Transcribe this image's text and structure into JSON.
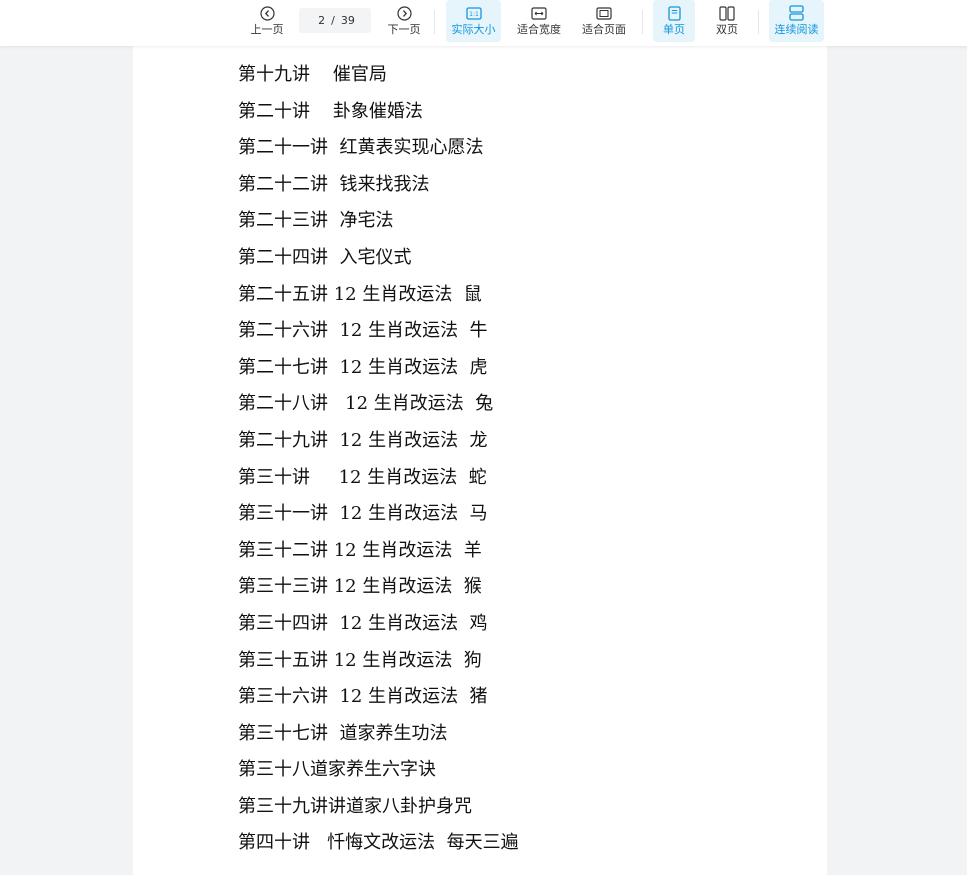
{
  "toolbar": {
    "prev_label": "上一页",
    "next_label": "下一页",
    "current_page": "2",
    "page_separator": "/",
    "total_pages": "39",
    "actual_size_label": "实际大小",
    "fit_width_label": "适合宽度",
    "fit_page_label": "适合页面",
    "single_page_label": "单页",
    "double_page_label": "双页",
    "continuous_label": "连续阅读",
    "accent_color": "#1296db"
  },
  "document": {
    "toc_lines": [
      "第十九讲    催官局",
      "第二十讲    卦象催婚法",
      "第二十一讲  红黄表实现心愿法",
      "第二十二讲  钱来找我法",
      "第二十三讲  净宅法",
      "第二十四讲  入宅仪式",
      "第二十五讲 12 生肖改运法  鼠",
      "第二十六讲  12 生肖改运法  牛",
      "第二十七讲  12 生肖改运法  虎",
      "第二十八讲   12 生肖改运法  兔",
      "第二十九讲  12 生肖改运法  龙",
      "第三十讲     12 生肖改运法  蛇",
      "第三十一讲  12 生肖改运法  马",
      "第三十二讲 12 生肖改运法  羊",
      "第三十三讲 12 生肖改运法  猴",
      "第三十四讲  12 生肖改运法  鸡",
      "第三十五讲 12 生肖改运法  狗",
      "第三十六讲  12 生肖改运法  猪",
      "第三十七讲  道家养生功法",
      "第三十八道家养生六字诀",
      "第三十九讲讲道家八卦护身咒",
      "第四十讲   忏悔文改运法  每天三遍"
    ]
  }
}
